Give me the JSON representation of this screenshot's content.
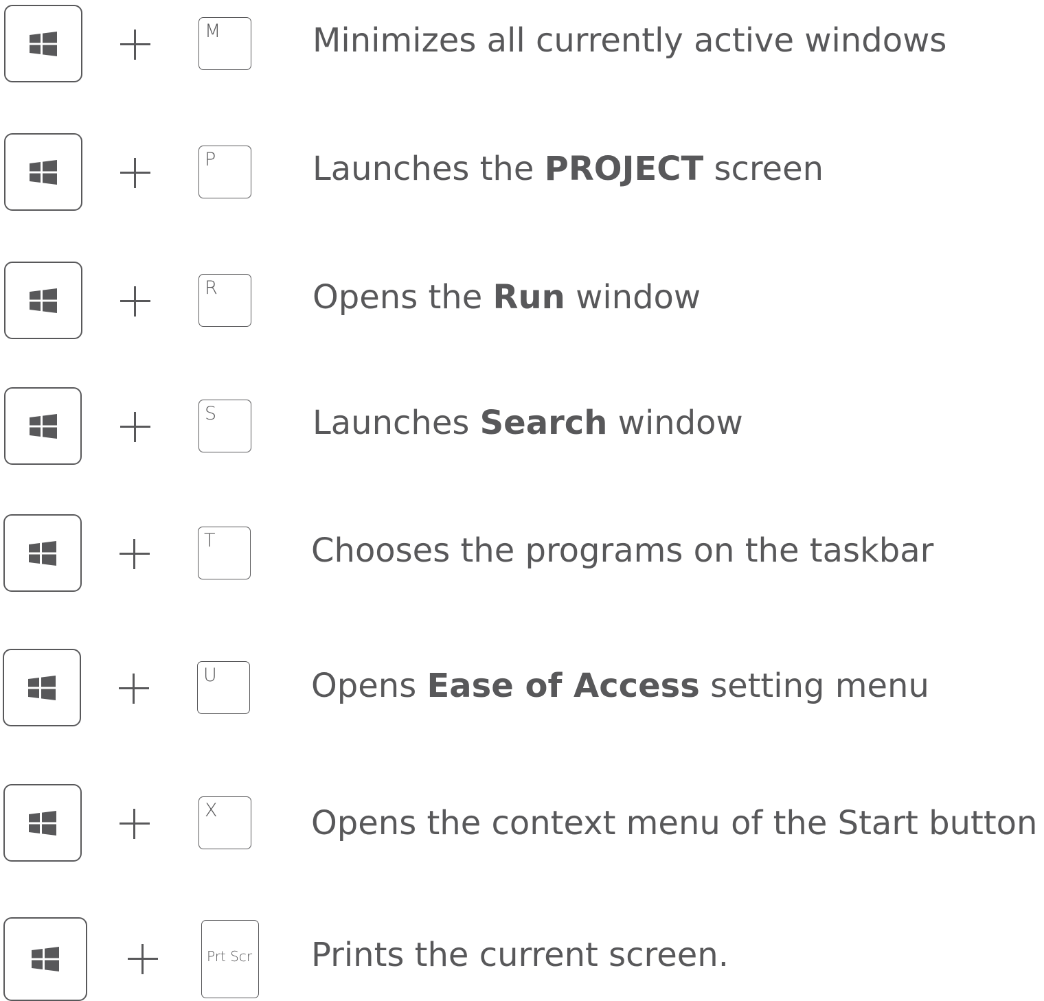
{
  "shortcuts": [
    {
      "modifier": "Windows",
      "key": "M",
      "before": "Minimizes all currently active windows",
      "bold": "",
      "after": ""
    },
    {
      "modifier": "Windows",
      "key": "P",
      "before": "Launches the ",
      "bold": "PROJECT",
      "after": " screen"
    },
    {
      "modifier": "Windows",
      "key": "R",
      "before": "Opens the ",
      "bold": "Run",
      "after": " window"
    },
    {
      "modifier": "Windows",
      "key": "S",
      "before": "Launches ",
      "bold": "Search",
      "after": " window"
    },
    {
      "modifier": "Windows",
      "key": "T",
      "before": "Chooses the programs on the taskbar",
      "bold": "",
      "after": ""
    },
    {
      "modifier": "Windows",
      "key": "U",
      "before": "Opens ",
      "bold": "Ease of Access",
      "after": " setting menu"
    },
    {
      "modifier": "Windows",
      "key": "X",
      "before": "Opens the context menu of the Start button",
      "bold": "",
      "after": ""
    },
    {
      "modifier": "Windows",
      "key": "Prt Scr",
      "before": "Prints the current screen.",
      "bold": "",
      "after": ""
    }
  ],
  "icons": {
    "modifier_icon": "windows-logo-icon",
    "combine_icon": "plus-icon"
  },
  "colors": {
    "foreground": "#58585a",
    "background": "#ffffff"
  }
}
